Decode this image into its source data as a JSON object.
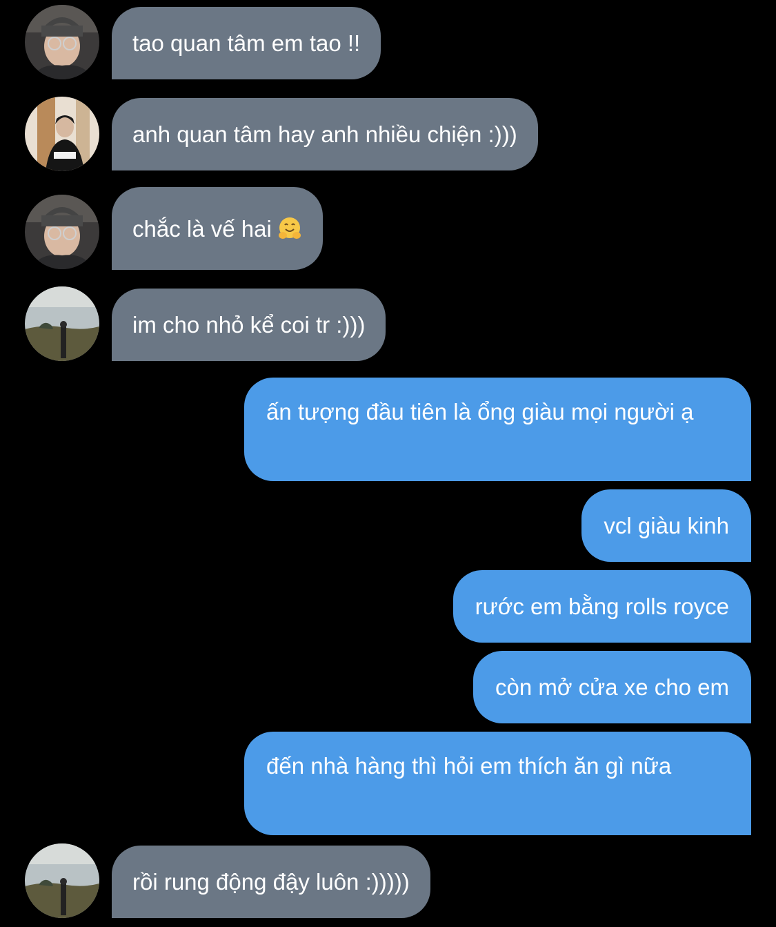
{
  "conversation": {
    "messages": [
      {
        "sender": "incoming",
        "avatar": "avatar-beanie-glasses",
        "text": "tao quan tâm em tao !!"
      },
      {
        "sender": "incoming",
        "avatar": "avatar-doorway",
        "text": "anh quan tâm hay anh nhiều chiện :)))"
      },
      {
        "sender": "incoming",
        "avatar": "avatar-beanie-glasses",
        "text": "chắc là vế hai",
        "emoji": "hugging-face-emoji"
      },
      {
        "sender": "incoming",
        "avatar": "avatar-field-sky",
        "text": "im cho nhỏ kể coi tr :)))"
      },
      {
        "sender": "outgoing",
        "text": "ấn tượng đầu tiên là ổng giàu mọi người ạ"
      },
      {
        "sender": "outgoing",
        "text": "vcl giàu kinh"
      },
      {
        "sender": "outgoing",
        "text": "rước em bằng rolls royce"
      },
      {
        "sender": "outgoing",
        "text": "còn mở cửa xe cho em"
      },
      {
        "sender": "outgoing",
        "text": "đến nhà hàng thì hỏi em thích ăn gì nữa"
      },
      {
        "sender": "incoming",
        "avatar": "avatar-field-sky",
        "text": "rồi rung động đậy luôn :)))))"
      }
    ]
  },
  "colors": {
    "background": "#000000",
    "incoming_bubble": "#6b7785",
    "outgoing_bubble": "#4c9be8",
    "text": "#ffffff"
  }
}
